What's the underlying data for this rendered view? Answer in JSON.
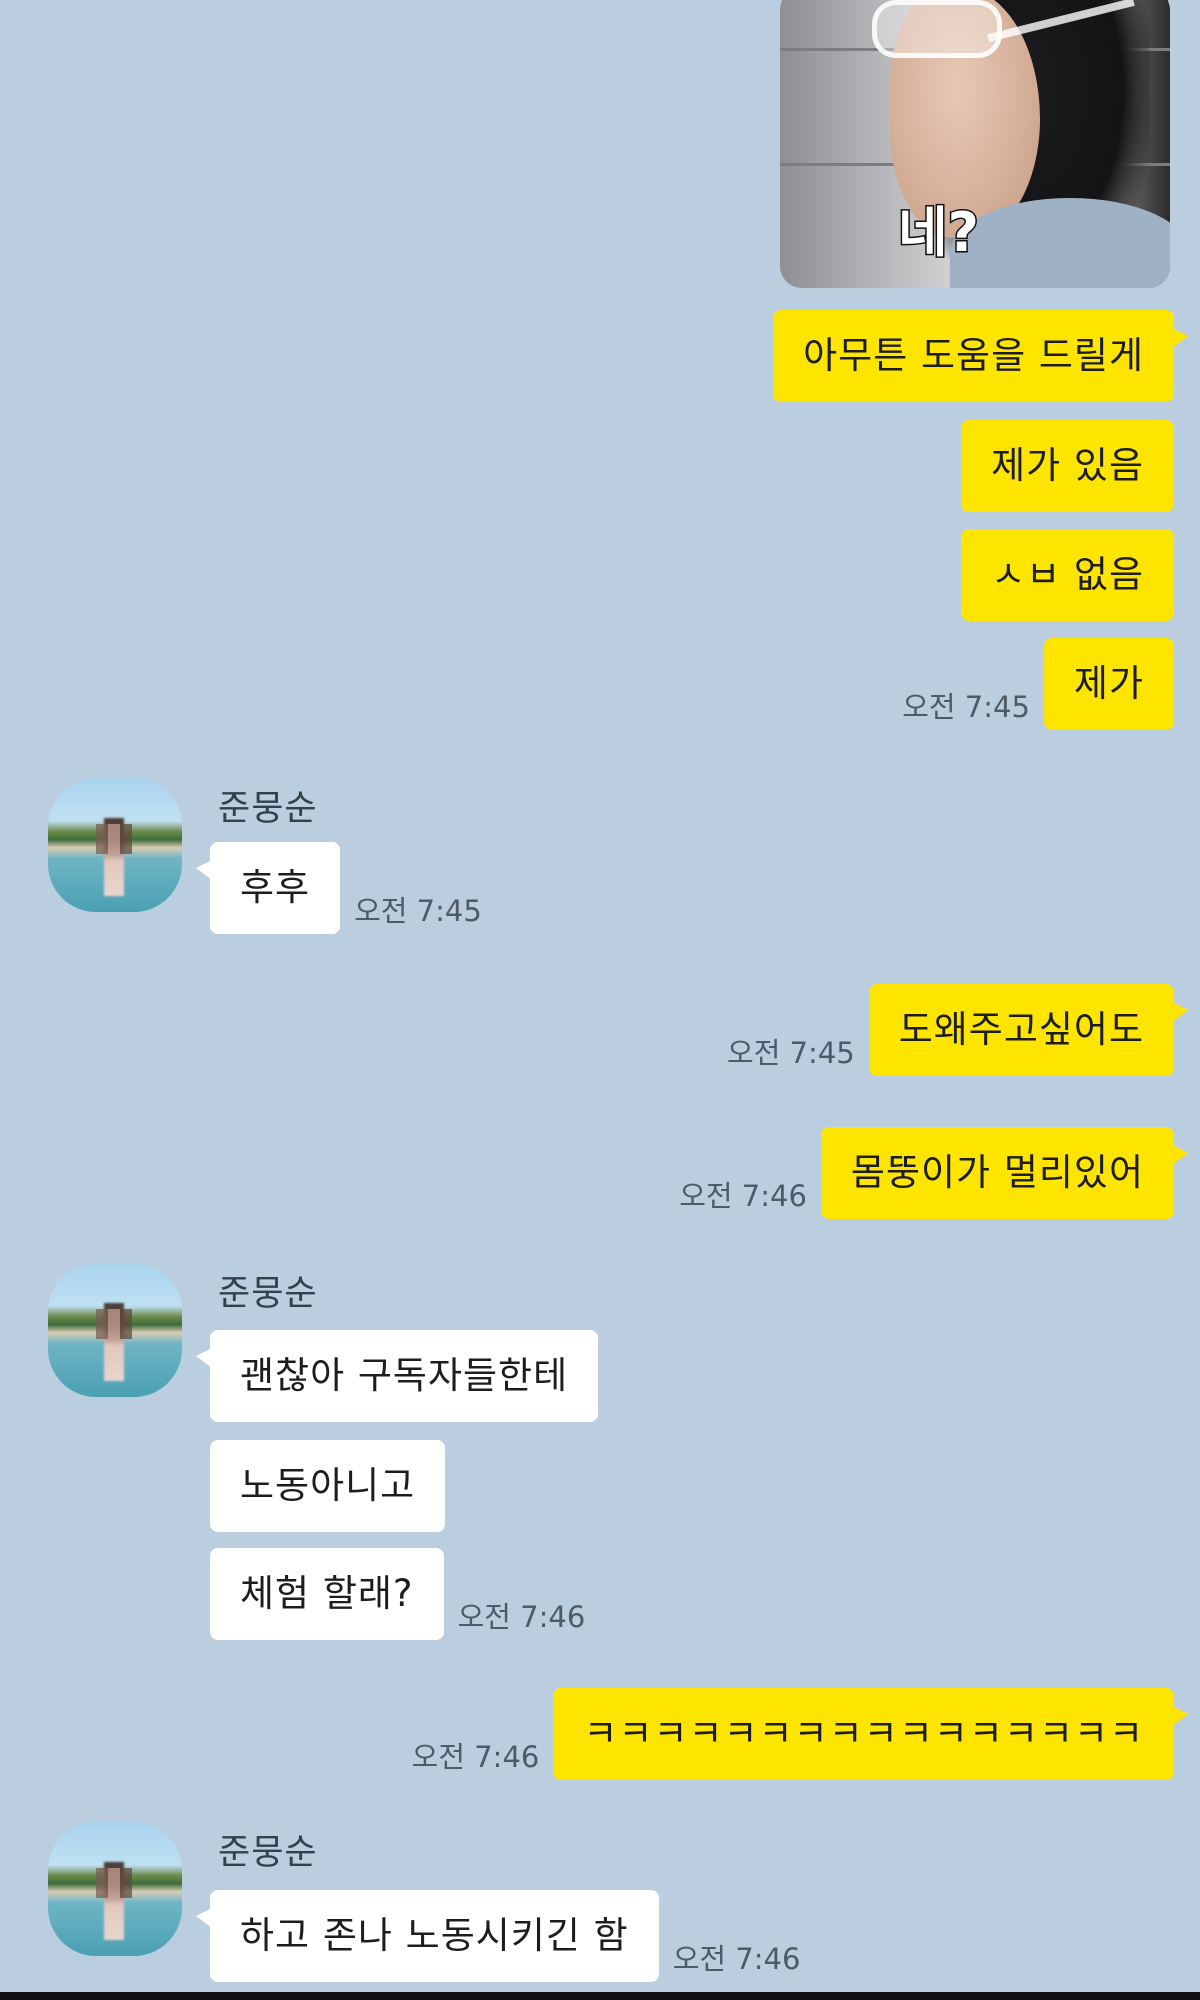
{
  "chat": {
    "image_caption": "네?",
    "messages": [
      {
        "text": "아무튼 도움을 드릴게"
      },
      {
        "text": "제가 있음"
      },
      {
        "text": "ㅅㅂ 없음"
      },
      {
        "text": "제가",
        "time": "오전 7:45"
      },
      {
        "sender": "준뭉순",
        "text": "후후",
        "time": "오전 7:45"
      },
      {
        "text": "도왜주고싶어도",
        "time": "오전 7:45"
      },
      {
        "text": "몸뚱이가 멀리있어",
        "time": "오전 7:46"
      },
      {
        "sender": "준뭉순",
        "text": "괜찮아 구독자들한테"
      },
      {
        "text": "노동아니고"
      },
      {
        "text": "체험 할래?",
        "time": "오전 7:46"
      },
      {
        "text": "ㅋㅋㅋㅋㅋㅋㅋㅋㅋㅋㅋㅋㅋㅋㅋㅋ",
        "time": "오전 7:46"
      },
      {
        "sender": "준뭉순",
        "text": "하고 존나 노동시키긴 함",
        "time": "오전 7:46"
      }
    ]
  },
  "colors": {
    "background": "#bacee0",
    "my_bubble": "#fee500",
    "their_bubble": "#ffffff"
  }
}
